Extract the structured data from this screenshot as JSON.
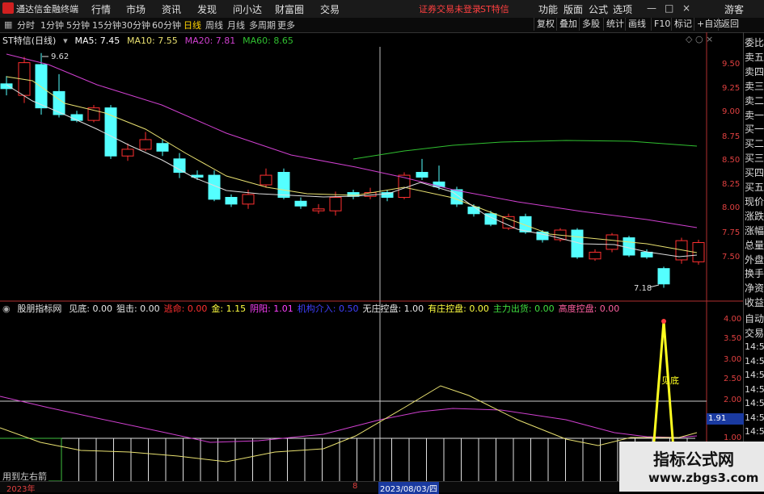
{
  "app": {
    "title": "通达信金融终端"
  },
  "menu": {
    "items": [
      "行情",
      "市场",
      "资讯",
      "发现",
      "问小达",
      "财富圈",
      "交易"
    ],
    "login_status": "证券交易未登录",
    "stock": "ST特信",
    "right": [
      "功能",
      "版面",
      "公式",
      "选项"
    ],
    "guest": "游客"
  },
  "periods": {
    "items": [
      "分时",
      "1分钟",
      "5分钟",
      "15分钟",
      "30分钟",
      "60分钟",
      "日线",
      "周线",
      "月线",
      "多周期",
      "更多"
    ],
    "active": "日线"
  },
  "toolbar": {
    "items": [
      "复权",
      "叠加",
      "多股",
      "统计",
      "画线",
      "F10",
      "标记",
      "+自选",
      "返回"
    ]
  },
  "main_chart": {
    "title": "ST特信(日线)",
    "ma_labels": {
      "ma5": "MA5: 7.45",
      "ma10": "MA10: 7.55",
      "ma20": "MA20: 7.81",
      "ma60": "MA60: 8.65"
    },
    "high_label": "9.62",
    "low_label": "7.18",
    "y_ticks": [
      "9.50",
      "9.25",
      "9.00",
      "8.75",
      "8.50",
      "8.25",
      "8.00",
      "7.75",
      "7.50"
    ],
    "colors": {
      "up": "#ff3030",
      "down": "#54ffff",
      "ma5": "#ffffff",
      "ma10": "#e8e070",
      "ma20": "#d040d0",
      "ma60": "#30c030"
    }
  },
  "right_panel": {
    "items": [
      "委比",
      "卖五",
      "卖四",
      "卖三",
      "卖二",
      "卖一",
      "买一",
      "买二",
      "买三",
      "买四",
      "买五",
      "现价",
      "涨跌",
      "涨幅",
      "总量",
      "外盘",
      "换手",
      "净资",
      "收益"
    ],
    "items2": [
      "自动",
      "交易",
      "14:56",
      "14:56",
      "14:56",
      "14:56",
      "14:56",
      "14:56",
      "14:56",
      "14:56"
    ]
  },
  "indicator": {
    "name": "股朋指标网",
    "values": [
      {
        "label": "见底: 0.00",
        "color": "#e8e8e8"
      },
      {
        "label": "狙击: 0.00",
        "color": "#e8e8e8"
      },
      {
        "label": "逃命: 0.00",
        "color": "#ff3030"
      },
      {
        "label": "金: 1.15",
        "color": "#ffff40"
      },
      {
        "label": "阴阳: 1.01",
        "color": "#ff40ff"
      },
      {
        "label": "机构介入: 0.50",
        "color": "#4040ff"
      },
      {
        "label": "无庄控盘: 1.00",
        "color": "#e8e8e8"
      },
      {
        "label": "有庄控盘: 0.00",
        "color": "#ffff40"
      },
      {
        "label": "主力出货: 0.00",
        "color": "#40e040"
      },
      {
        "label": "高度控盘: 0.00",
        "color": "#ff60a0"
      }
    ],
    "y_ticks": [
      "4.00",
      "3.50",
      "3.00",
      "2.50",
      "2.00",
      "1.50",
      "1.00"
    ],
    "signal_label": "见底",
    "current": "1.91",
    "bottom_left": "用到左右箭"
  },
  "timeline": {
    "year": "2023年",
    "marker": "8",
    "cursor_date": "2023/08/03/四"
  },
  "watermark": {
    "title": "指标公式网",
    "url": "www.zbgs3.com"
  }
}
